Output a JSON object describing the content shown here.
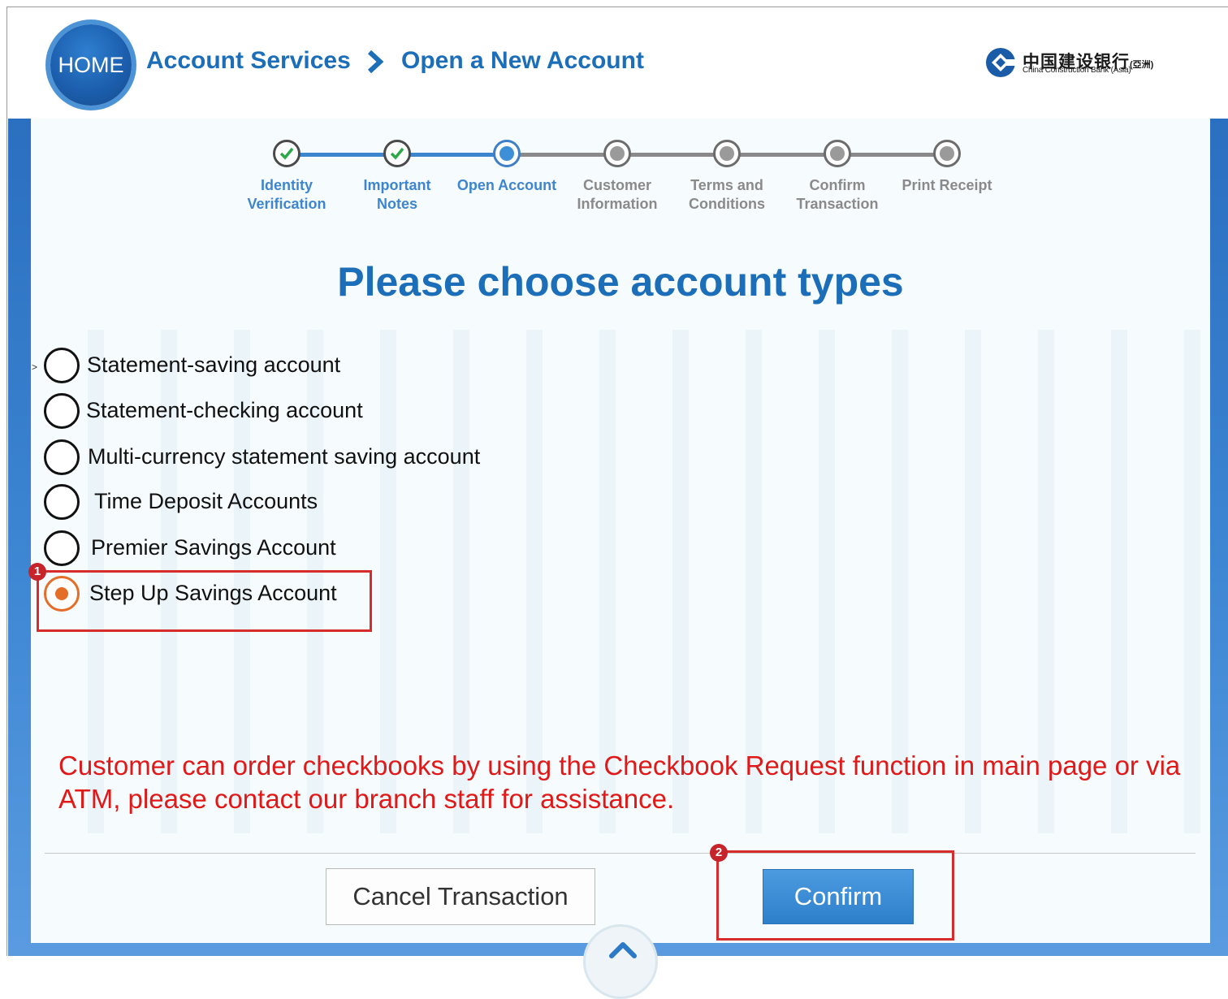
{
  "header": {
    "home_label": "HOME",
    "breadcrumb": [
      "Account Services",
      "Open a New Account"
    ],
    "bank_name_cn": "中国建设银行",
    "bank_name_cn_suffix": "(亞洲)",
    "bank_name_en": "China Construction Bank (Asia)"
  },
  "steps": [
    {
      "line1": "Identity",
      "line2": "Verification",
      "state": "done"
    },
    {
      "line1": "Important",
      "line2": "Notes",
      "state": "done"
    },
    {
      "line1": "Open Account",
      "line2": "",
      "state": "current"
    },
    {
      "line1": "Customer",
      "line2": "Information",
      "state": "pending"
    },
    {
      "line1": "Terms and",
      "line2": "Conditions",
      "state": "pending"
    },
    {
      "line1": "Confirm",
      "line2": "Transaction",
      "state": "pending"
    },
    {
      "line1": "Print Receipt",
      "line2": "",
      "state": "pending"
    }
  ],
  "page_title": "Please choose account types",
  "account_options": [
    {
      "label": "Statement-saving account",
      "selected": false
    },
    {
      "label": "Statement-checking account",
      "selected": false
    },
    {
      "label": "Multi-currency statement saving account",
      "selected": false
    },
    {
      "label": "Time Deposit Accounts",
      "selected": false
    },
    {
      "label": "Premier Savings Account",
      "selected": false
    },
    {
      "label": "Step Up Savings Account",
      "selected": true
    }
  ],
  "cursor_glyph": ">",
  "annotations": [
    "1",
    "2"
  ],
  "notice": "Customer can order checkbooks by using the Checkbook Request function in main page or via ATM, please contact our branch staff for assistance.",
  "buttons": {
    "cancel": "Cancel Transaction",
    "confirm": "Confirm"
  },
  "colors": {
    "primary_blue": "#1c6eb8",
    "selected_orange": "#e46d28",
    "notice_red": "#e01818",
    "annotation_red": "#d62c2c"
  }
}
